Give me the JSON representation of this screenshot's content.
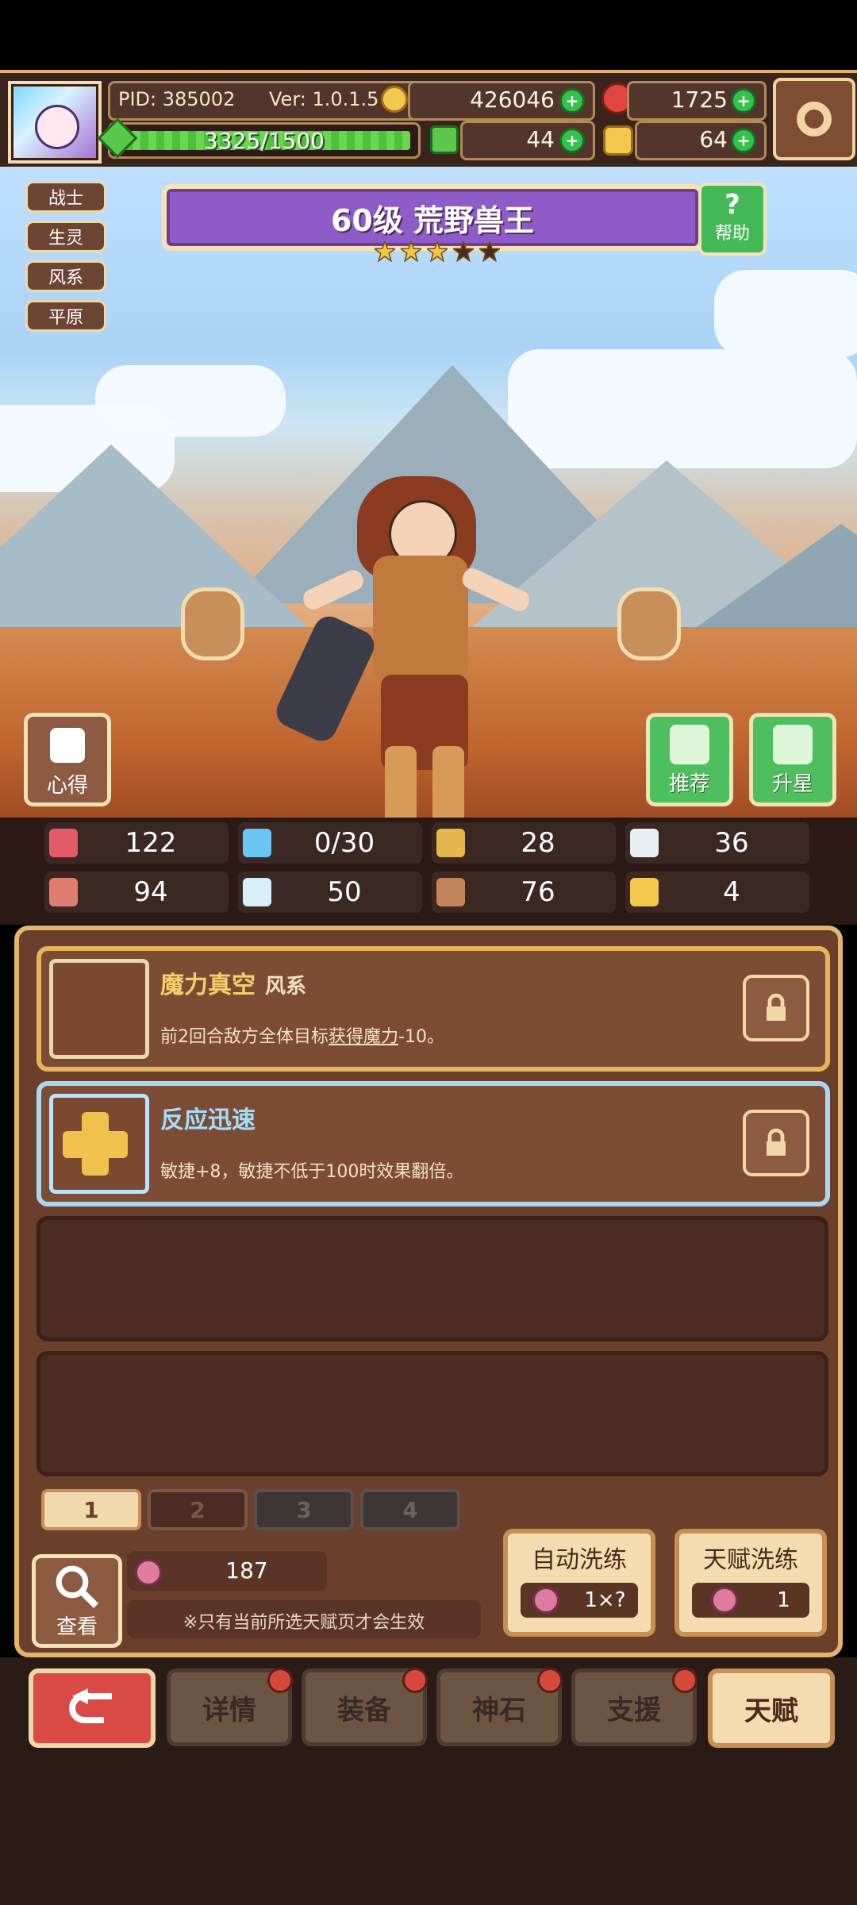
{
  "hud": {
    "pid_text": "PID: 385002",
    "ver_text": "Ver: 1.0.1.5",
    "gold": "426046",
    "gems": "1725",
    "xp_text": "3325/1500",
    "xp_fill_percent": 100,
    "clover": "44",
    "hand": "64"
  },
  "character": {
    "tags": [
      "战士",
      "生灵",
      "风系",
      "平原"
    ],
    "level_title": "60级 荒野兽王",
    "stars_filled": 3,
    "stars_total": 5,
    "help_label": "帮助",
    "side_left_label": "心得",
    "recommend_label": "推荐",
    "upgrade_label": "升星"
  },
  "stats": {
    "hp": "122",
    "mana": "0/30",
    "armor": "28",
    "speed": "36",
    "attack": "94",
    "magic": "50",
    "luck": "76",
    "horse": "4"
  },
  "talents": [
    {
      "title": "魔力真空",
      "element": "风系",
      "desc_before": "前2回合敌方全体目标",
      "desc_link": "获得魔力",
      "desc_after": "-10。"
    },
    {
      "title": "反应迅速",
      "element": "",
      "desc_before": "敏捷+8，敏捷不低于100时效果翻倍。",
      "desc_link": "",
      "desc_after": ""
    }
  ],
  "pages": [
    "1",
    "2",
    "3",
    "4"
  ],
  "bottom": {
    "view_label": "查看",
    "potion_count": "187",
    "note": "※只有当前所选天赋页才会生效",
    "auto_refine_label": "自动洗练",
    "auto_refine_cost": "1×?",
    "talent_refine_label": "天赋洗练",
    "talent_refine_cost": "1"
  },
  "nav": {
    "details": "详情",
    "equip": "装备",
    "stone": "神石",
    "support": "支援",
    "talent": "天赋"
  },
  "colors": {
    "gold_accent": "#e6b25c",
    "blue_accent": "#a9d7f2",
    "panel_bg": "#6a3f2b",
    "green_btn": "#4dbf5f",
    "red_btn": "#d94a45"
  }
}
